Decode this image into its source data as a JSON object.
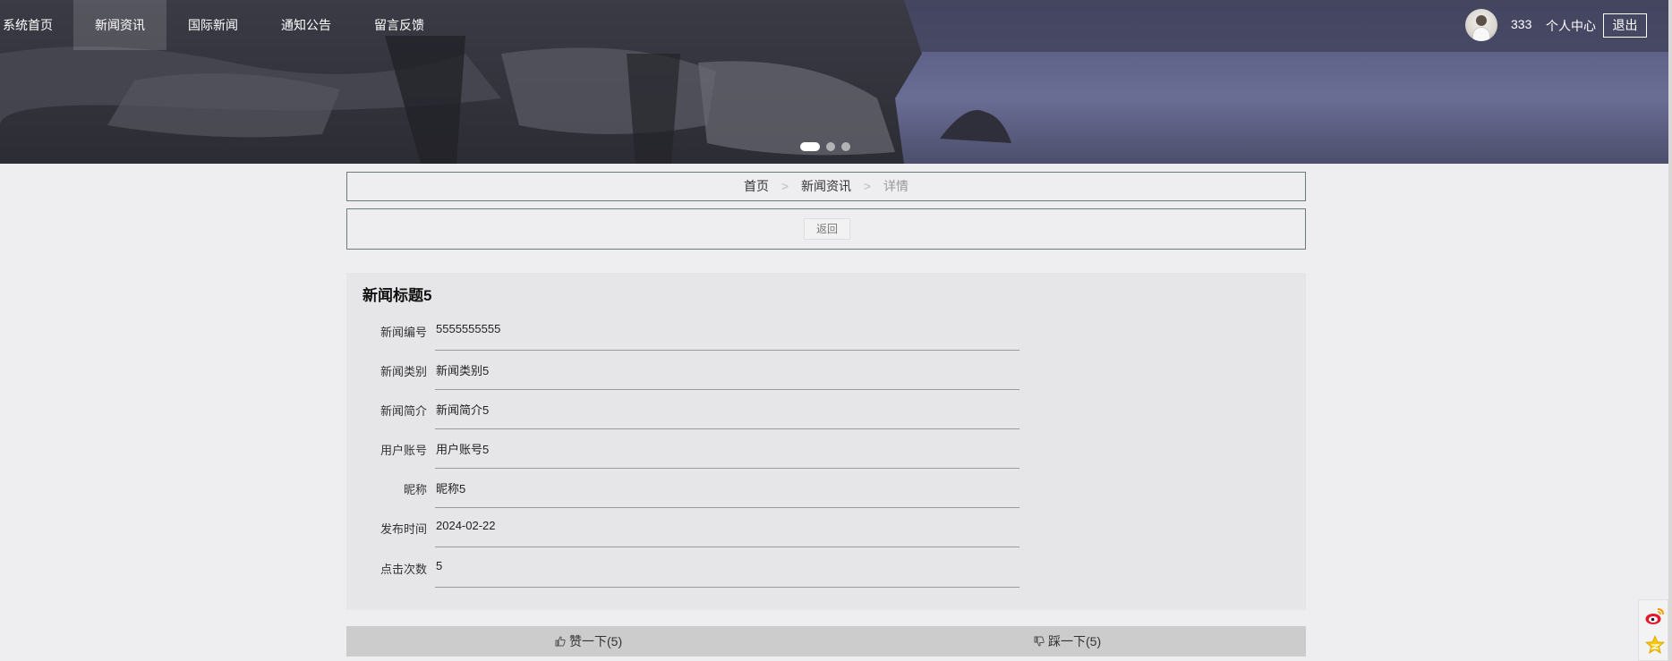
{
  "nav": {
    "items": [
      {
        "label": "系统首页",
        "active": false
      },
      {
        "label": "新闻资讯",
        "active": true
      },
      {
        "label": "国际新闻",
        "active": false
      },
      {
        "label": "通知公告",
        "active": false
      },
      {
        "label": "留言反馈",
        "active": false
      }
    ],
    "username": "333",
    "center_label": "个人中心",
    "logout_label": "退出"
  },
  "carousel": {
    "slides": 3,
    "active_index": 0
  },
  "breadcrumb": {
    "home": "首页",
    "section": "新闻资讯",
    "current": "详情",
    "separator": ">"
  },
  "back_label": "返回",
  "detail": {
    "title": "新闻标题5",
    "fields": [
      {
        "label": "新闻编号",
        "value": "5555555555"
      },
      {
        "label": "新闻类别",
        "value": "新闻类别5"
      },
      {
        "label": "新闻简介",
        "value": "新闻简介5"
      },
      {
        "label": "用户账号",
        "value": "用户账号5"
      },
      {
        "label": "昵称",
        "value": "昵称5"
      },
      {
        "label": "发布时间",
        "value": "2024-02-22"
      },
      {
        "label": "点击次数",
        "value": "5"
      }
    ]
  },
  "votes": {
    "like_label": "赞一下(5)",
    "dislike_label": "踩一下(5)"
  },
  "side_icons": [
    "weibo-icon",
    "qzone-icon"
  ]
}
